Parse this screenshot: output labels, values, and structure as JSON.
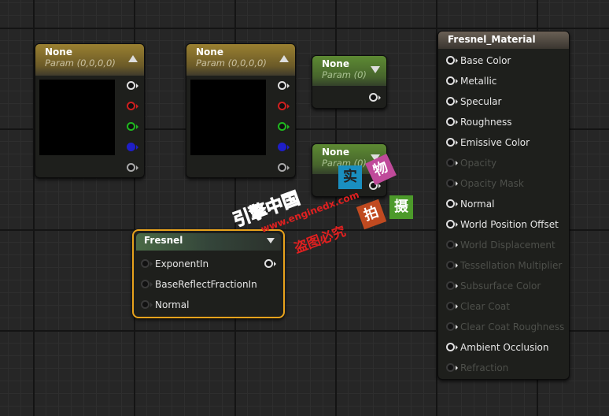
{
  "nodes": {
    "vec1": {
      "title": "None",
      "subtitle": "Param (0,0,0,0)"
    },
    "vec2": {
      "title": "None",
      "subtitle": "Param (0,0,0,0)"
    },
    "scalar1": {
      "title": "None",
      "subtitle": "Param (0)"
    },
    "scalar2": {
      "title": "None",
      "subtitle": "Param (0)"
    },
    "fresnel": {
      "title": "Fresnel",
      "inputs": [
        "ExponentIn",
        "BaseReflectFractionIn",
        "Normal"
      ]
    },
    "material": {
      "title": "Fresnel_Material",
      "inputs": [
        {
          "label": "Base Color",
          "enabled": true
        },
        {
          "label": "Metallic",
          "enabled": true
        },
        {
          "label": "Specular",
          "enabled": true
        },
        {
          "label": "Roughness",
          "enabled": true
        },
        {
          "label": "Emissive Color",
          "enabled": true
        },
        {
          "label": "Opacity",
          "enabled": false
        },
        {
          "label": "Opacity Mask",
          "enabled": false
        },
        {
          "label": "Normal",
          "enabled": true
        },
        {
          "label": "World Position Offset",
          "enabled": true
        },
        {
          "label": "World Displacement",
          "enabled": false
        },
        {
          "label": "Tessellation Multiplier",
          "enabled": false
        },
        {
          "label": "Subsurface Color",
          "enabled": false
        },
        {
          "label": "Clear Coat",
          "enabled": false
        },
        {
          "label": "Clear Coat Roughness",
          "enabled": false
        },
        {
          "label": "Ambient Occlusion",
          "enabled": true
        },
        {
          "label": "Refraction",
          "enabled": false
        }
      ]
    }
  },
  "pin_colors": {
    "white": "#e0e0e0",
    "red": "#d01f1f",
    "green": "#1fb81f",
    "blue": "#1f1fc8"
  },
  "accent": {
    "selected_border": "#e8a21c"
  },
  "watermark": {
    "line1": "引擎中国",
    "url": "www.enginedx.com",
    "line2": "盗图必究",
    "stamps": [
      "实",
      "物",
      "拍",
      "摄"
    ]
  }
}
